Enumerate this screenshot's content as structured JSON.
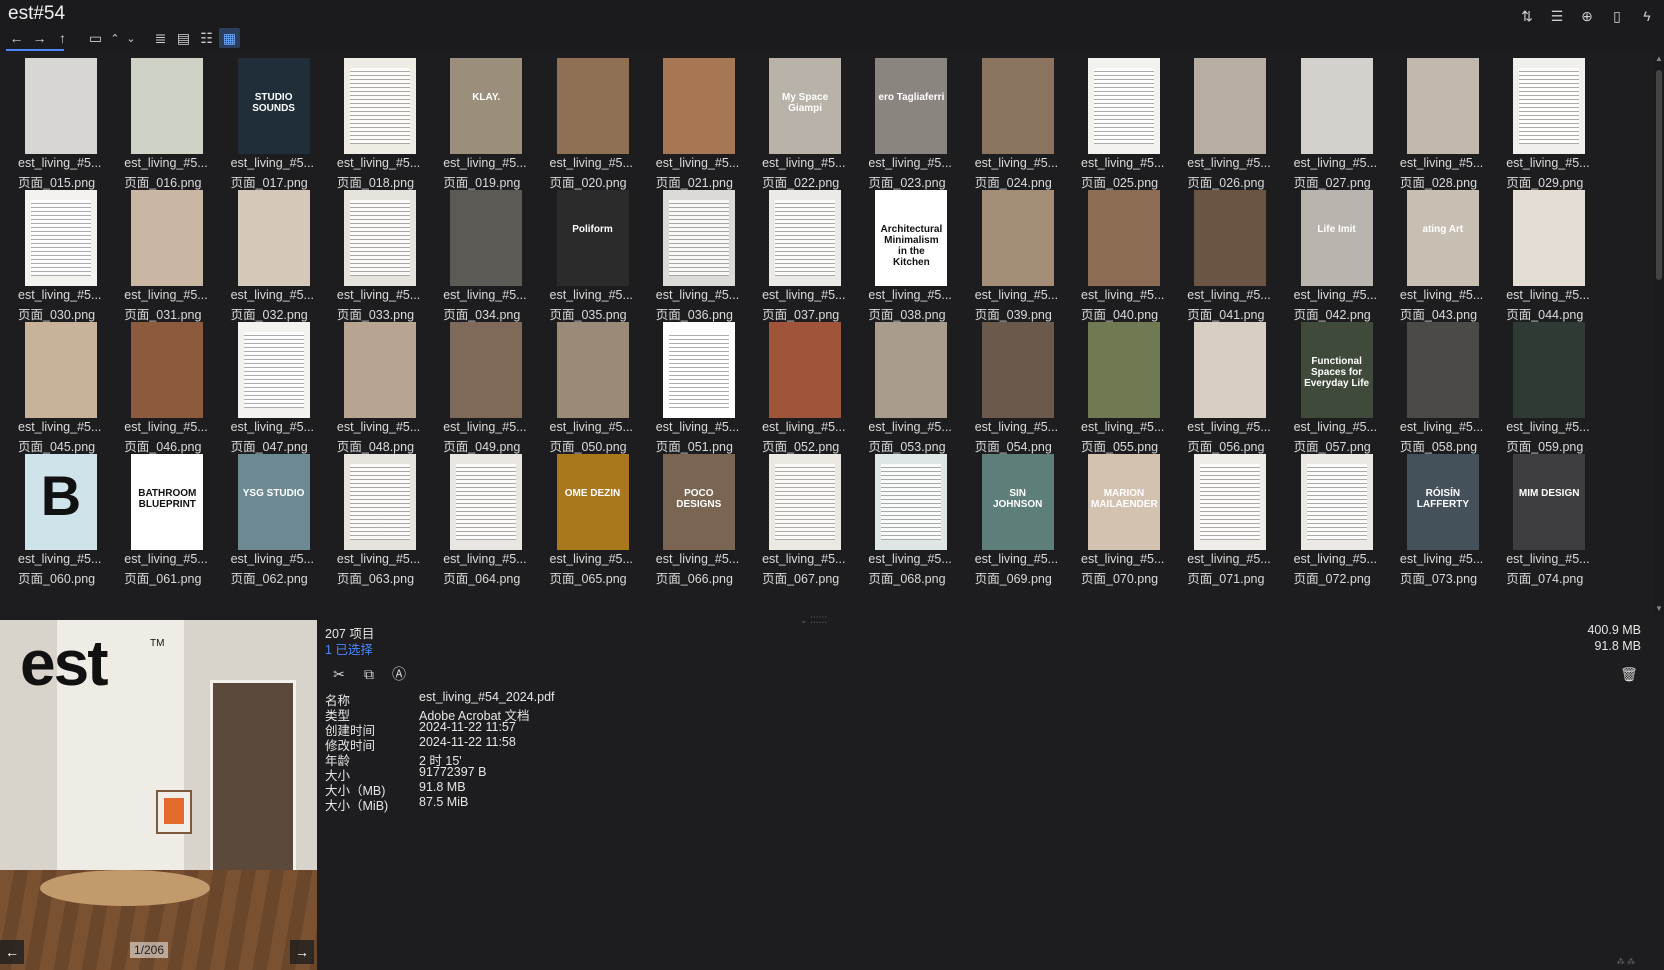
{
  "window": {
    "title": "est#54"
  },
  "toolbar": {
    "buttons": [
      "back-icon",
      "forward-icon",
      "up-icon",
      "folder-icon",
      "chevron-up-icon",
      "chevron-down-icon",
      "list-view-icon",
      "details-view-icon",
      "tree-view-icon",
      "thumbnail-view-icon"
    ],
    "active": "thumbnail-view-icon"
  },
  "window_tools": [
    "sort-icon",
    "list-options-icon",
    "add-icon",
    "clipboard-icon",
    "lightning-icon"
  ],
  "grid": {
    "files": [
      {
        "name": "est_living_#5...",
        "page": "页面_015.png",
        "thumb": "#d8d6d2",
        "text": ""
      },
      {
        "name": "est_living_#5...",
        "page": "页面_016.png",
        "thumb": "#cfd3c6",
        "text": ""
      },
      {
        "name": "est_living_#5...",
        "page": "页面_017.png",
        "thumb": "#1f2e38",
        "text": "STUDIO SOUNDS"
      },
      {
        "name": "est_living_#5...",
        "page": "页面_018.png",
        "thumb": "#efece4",
        "text": ""
      },
      {
        "name": "est_living_#5...",
        "page": "页面_019.png",
        "thumb": "#9b8f7c",
        "text": "KLAY."
      },
      {
        "name": "est_living_#5...",
        "page": "页面_020.png",
        "thumb": "#8f7054",
        "text": ""
      },
      {
        "name": "est_living_#5...",
        "page": "页面_021.png",
        "thumb": "#a77652",
        "text": ""
      },
      {
        "name": "est_living_#5...",
        "page": "页面_022.png",
        "thumb": "#b9b2a8",
        "text": "My Space Giampi"
      },
      {
        "name": "est_living_#5...",
        "page": "页面_023.png",
        "thumb": "#8b8580",
        "text": "ero Tagliaferri"
      },
      {
        "name": "est_living_#5...",
        "page": "页面_024.png",
        "thumb": "#8a7460",
        "text": ""
      },
      {
        "name": "est_living_#5...",
        "page": "页面_025.png",
        "thumb": "#f3f2ef",
        "text": ""
      },
      {
        "name": "est_living_#5...",
        "page": "页面_026.png",
        "thumb": "#b8ada2",
        "text": ""
      },
      {
        "name": "est_living_#5...",
        "page": "页面_027.png",
        "thumb": "#d4d0cb",
        "text": ""
      },
      {
        "name": "est_living_#5...",
        "page": "页面_028.png",
        "thumb": "#c2b9ae",
        "text": ""
      },
      {
        "name": "est_living_#5...",
        "page": "页面_029.png",
        "thumb": "#f1efec",
        "text": ""
      },
      {
        "name": "est_living_#5...",
        "page": "页面_030.png",
        "thumb": "#f3f2ef",
        "text": ""
      },
      {
        "name": "est_living_#5...",
        "page": "页面_031.png",
        "thumb": "#c9b7a4",
        "text": ""
      },
      {
        "name": "est_living_#5...",
        "page": "页面_032.png",
        "thumb": "#d5c8ba",
        "text": ""
      },
      {
        "name": "est_living_#5...",
        "page": "页面_033.png",
        "thumb": "#e6e2dc",
        "text": ""
      },
      {
        "name": "est_living_#5...",
        "page": "页面_034.png",
        "thumb": "#5c5a55",
        "text": ""
      },
      {
        "name": "est_living_#5...",
        "page": "页面_035.png",
        "thumb": "#2b2b2b",
        "text": "Poliform"
      },
      {
        "name": "est_living_#5...",
        "page": "页面_036.png",
        "thumb": "#dcdad6",
        "text": ""
      },
      {
        "name": "est_living_#5...",
        "page": "页面_037.png",
        "thumb": "#eceae6",
        "text": ""
      },
      {
        "name": "est_living_#5...",
        "page": "页面_038.png",
        "thumb": "#ffffff",
        "text": "Architectural Minimalism in the Kitchen"
      },
      {
        "name": "est_living_#5...",
        "page": "页面_039.png",
        "thumb": "#a38d77",
        "text": ""
      },
      {
        "name": "est_living_#5...",
        "page": "页面_040.png",
        "thumb": "#8c6c52",
        "text": ""
      },
      {
        "name": "est_living_#5...",
        "page": "页面_041.png",
        "thumb": "#6a5443",
        "text": ""
      },
      {
        "name": "est_living_#5...",
        "page": "页面_042.png",
        "thumb": "#b9b4ad",
        "text": "Life Imit"
      },
      {
        "name": "est_living_#5...",
        "page": "页面_043.png",
        "thumb": "#c8bfb3",
        "text": "ating Art"
      },
      {
        "name": "est_living_#5...",
        "page": "页面_044.png",
        "thumb": "#e3ddd3",
        "text": ""
      },
      {
        "name": "est_living_#5...",
        "page": "页面_045.png",
        "thumb": "#c7b29a",
        "text": ""
      },
      {
        "name": "est_living_#5...",
        "page": "页面_046.png",
        "thumb": "#8c5a3c",
        "text": ""
      },
      {
        "name": "est_living_#5...",
        "page": "页面_047.png",
        "thumb": "#f3f2ef",
        "text": ""
      },
      {
        "name": "est_living_#5...",
        "page": "页面_048.png",
        "thumb": "#b7a591",
        "text": ""
      },
      {
        "name": "est_living_#5...",
        "page": "页面_049.png",
        "thumb": "#7f6a59",
        "text": ""
      },
      {
        "name": "est_living_#5...",
        "page": "页面_050.png",
        "thumb": "#9a8a78",
        "text": ""
      },
      {
        "name": "est_living_#5...",
        "page": "页面_051.png",
        "thumb": "#ffffff",
        "text": ""
      },
      {
        "name": "est_living_#5...",
        "page": "页面_052.png",
        "thumb": "#a0553a",
        "text": ""
      },
      {
        "name": "est_living_#5...",
        "page": "页面_053.png",
        "thumb": "#a99c8d",
        "text": ""
      },
      {
        "name": "est_living_#5...",
        "page": "页面_054.png",
        "thumb": "#6b5a4b",
        "text": ""
      },
      {
        "name": "est_living_#5...",
        "page": "页面_055.png",
        "thumb": "#6f7a52",
        "text": ""
      },
      {
        "name": "est_living_#5...",
        "page": "页面_056.png",
        "thumb": "#d7cfc4",
        "text": ""
      },
      {
        "name": "est_living_#5...",
        "page": "页面_057.png",
        "thumb": "#3f4a3a",
        "text": "Functional Spaces for Everyday Life"
      },
      {
        "name": "est_living_#5...",
        "page": "页面_058.png",
        "thumb": "#4c4a47",
        "text": ""
      },
      {
        "name": "est_living_#5...",
        "page": "页面_059.png",
        "thumb": "#2f3a34",
        "text": ""
      },
      {
        "name": "est_living_#5...",
        "page": "页面_060.png",
        "thumb": "#cfe3ea",
        "text": "B"
      },
      {
        "name": "est_living_#5...",
        "page": "页面_061.png",
        "thumb": "#ffffff",
        "text": "BATHROOM BLUEPRINT"
      },
      {
        "name": "est_living_#5...",
        "page": "页面_062.png",
        "thumb": "#6d8a92",
        "text": "YSG STUDIO"
      },
      {
        "name": "est_living_#5...",
        "page": "页面_063.png",
        "thumb": "#e7e3dd",
        "text": ""
      },
      {
        "name": "est_living_#5...",
        "page": "页面_064.png",
        "thumb": "#e9e6e1",
        "text": ""
      },
      {
        "name": "est_living_#5...",
        "page": "页面_065.png",
        "thumb": "#a8771e",
        "text": "OME DEZIN"
      },
      {
        "name": "est_living_#5...",
        "page": "页面_066.png",
        "thumb": "#7a6552",
        "text": "POCO DESIGNS"
      },
      {
        "name": "est_living_#5...",
        "page": "页面_067.png",
        "thumb": "#ece8e2",
        "text": ""
      },
      {
        "name": "est_living_#5...",
        "page": "页面_068.png",
        "thumb": "#dfe6e6",
        "text": ""
      },
      {
        "name": "est_living_#5...",
        "page": "页面_069.png",
        "thumb": "#5e7e7a",
        "text": "SIN JOHNSON"
      },
      {
        "name": "est_living_#5...",
        "page": "页面_070.png",
        "thumb": "#d4c2b0",
        "text": "MARION MAILAENDER"
      },
      {
        "name": "est_living_#5...",
        "page": "页面_071.png",
        "thumb": "#f0ede8",
        "text": ""
      },
      {
        "name": "est_living_#5...",
        "page": "页面_072.png",
        "thumb": "#ece9e4",
        "text": ""
      },
      {
        "name": "est_living_#5...",
        "page": "页面_073.png",
        "thumb": "#44505a",
        "text": "RÓISÍN LAFFERTY"
      },
      {
        "name": "est_living_#5...",
        "page": "页面_074.png",
        "thumb": "#3e3e40",
        "text": "MIM DESIGN"
      }
    ]
  },
  "preview": {
    "logo": "est",
    "trademark": "TM",
    "pager": "1/206"
  },
  "info": {
    "count": "207 项目",
    "selected": "1 已选择",
    "size_total": "400.9 MB",
    "size_selected": "91.8 MB",
    "properties": [
      {
        "key": "名称",
        "value": "est_living_#54_2024.pdf"
      },
      {
        "key": "类型",
        "value": "Adobe Acrobat 文档"
      },
      {
        "key": "创建时间",
        "value": "2024-11-22  11:57"
      },
      {
        "key": "修改时间",
        "value": "2024-11-22  11:58"
      },
      {
        "key": "年龄",
        "value": "2 时 15'"
      },
      {
        "key": "大小",
        "value": "91772397 B"
      },
      {
        "key": "大小（MB)",
        "value": "91.8 MB"
      },
      {
        "key": "大小（MiB)",
        "value": "87.5 MiB"
      }
    ]
  }
}
